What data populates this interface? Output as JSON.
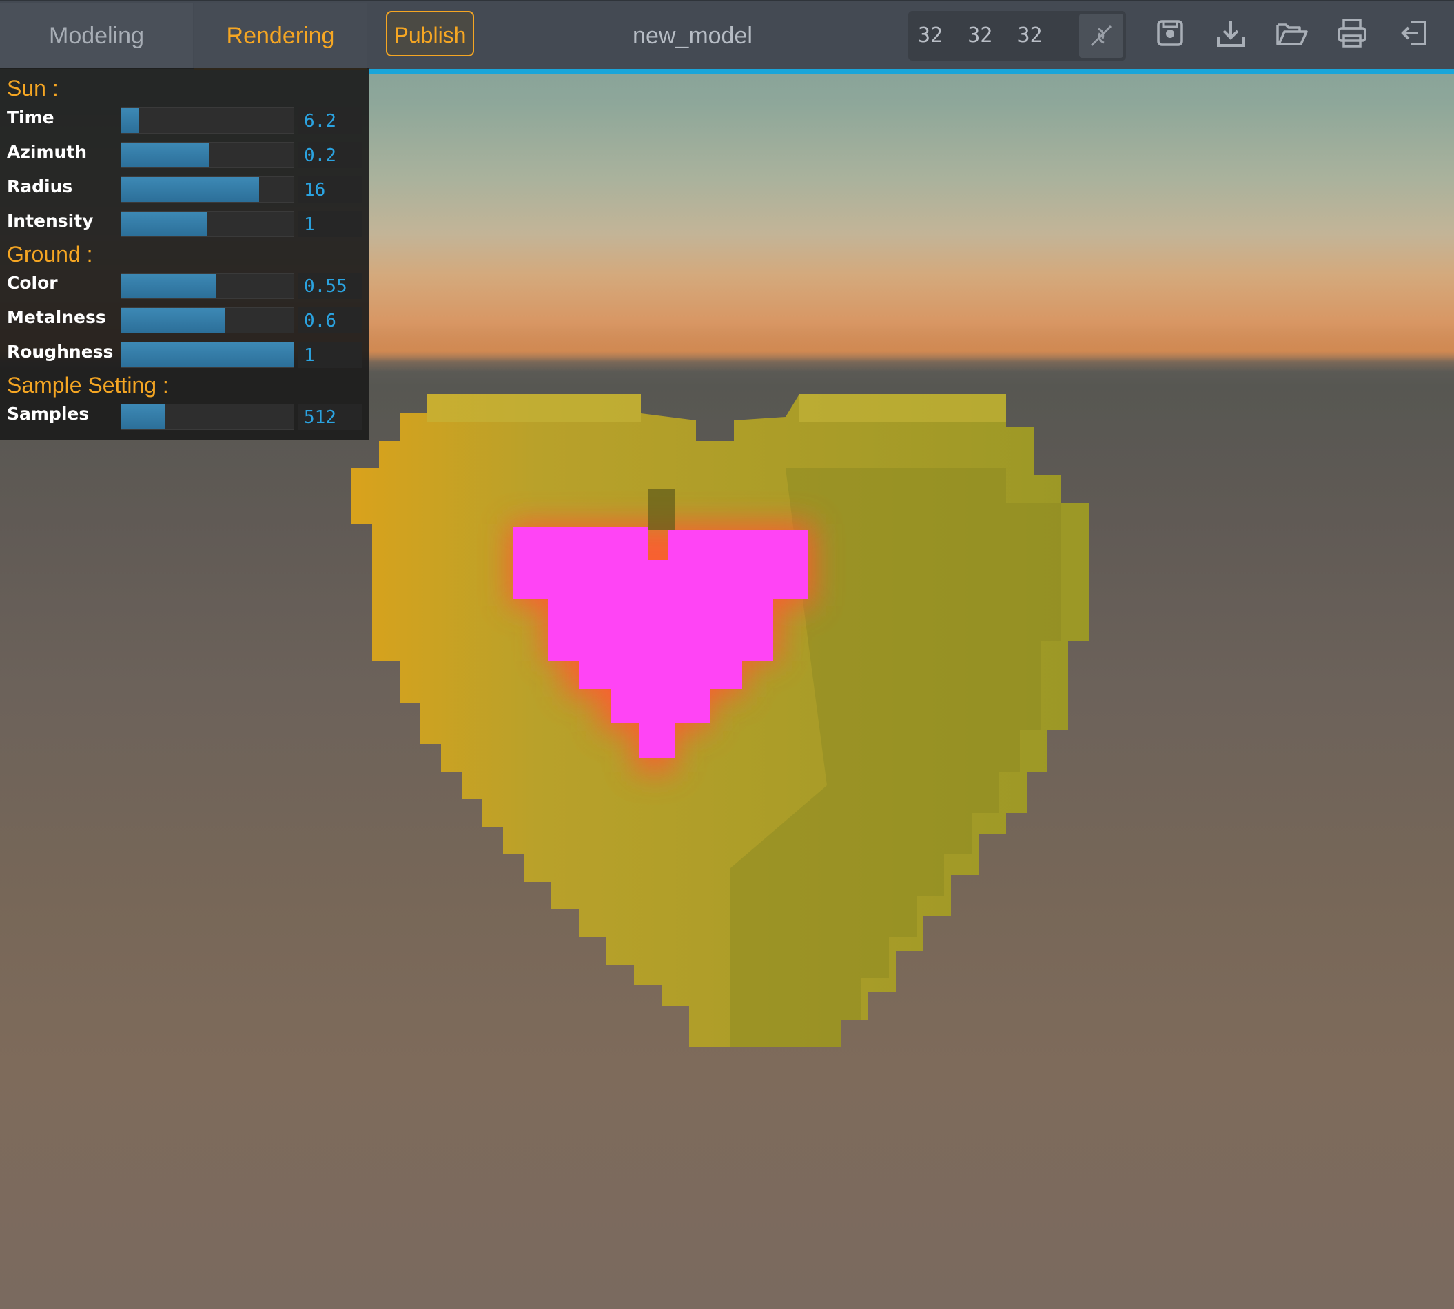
{
  "toolbar": {
    "tabs": [
      {
        "label": "Modeling",
        "active": false
      },
      {
        "label": "Rendering",
        "active": true
      }
    ],
    "publish_label": "Publish",
    "model_name": "new_model",
    "dimensions": "32  32  32",
    "icons": [
      "resize-icon",
      "save-icon",
      "download-icon",
      "open-folder-icon",
      "print-icon",
      "exit-icon"
    ]
  },
  "panel": {
    "sun": {
      "title": "Sun :",
      "rows": [
        {
          "label": "Time",
          "value": "6.2",
          "fill": 0.1
        },
        {
          "label": "Azimuth",
          "value": "0.2",
          "fill": 0.51
        },
        {
          "label": "Radius",
          "value": "16",
          "fill": 0.8
        },
        {
          "label": "Intensity",
          "value": "1",
          "fill": 0.5
        }
      ]
    },
    "ground": {
      "title": "Ground :",
      "rows": [
        {
          "label": "Color",
          "value": "0.55",
          "fill": 0.55
        },
        {
          "label": "Metalness",
          "value": "0.6",
          "fill": 0.6
        },
        {
          "label": "Roughness",
          "value": "1",
          "fill": 1.0
        }
      ]
    },
    "sample": {
      "title": "Sample Setting :",
      "rows": [
        {
          "label": "Samples",
          "value": "512",
          "fill": 0.25
        }
      ]
    }
  },
  "colors": {
    "accent": "#f5a623",
    "slider": "#3d89b5",
    "value_text": "#2ba3e0",
    "voxel_gold": "#a8a02a",
    "voxel_glow": "#ff44f0"
  }
}
